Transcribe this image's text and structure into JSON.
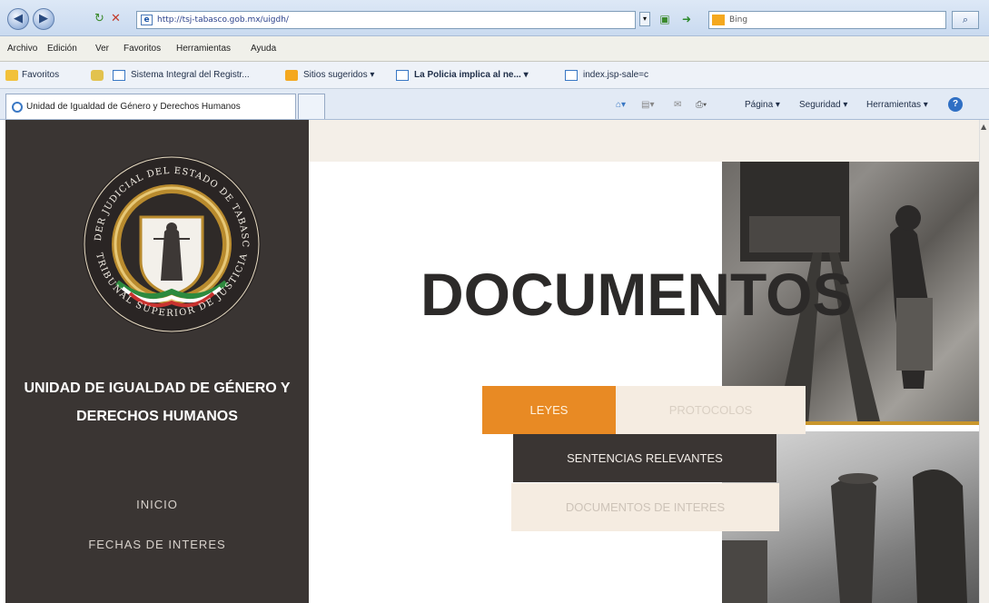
{
  "browser": {
    "address": "http://tsj-tabasco.gob.mx/uigdh/",
    "search_placeholder": "Bing",
    "menu": [
      "Archivo",
      "Edición",
      "Ver",
      "Favoritos",
      "Herramientas",
      "Ayuda"
    ],
    "favorites_label": "Favoritos",
    "favorites": [
      "Sistema Integral del Registr...",
      "Sitios sugeridos ▾",
      "La Policia implica al ne... ▾",
      "index.jsp-sale=c"
    ],
    "tab_title": "Unidad de Igualdad de Género y Derechos Humanos",
    "command_bar": [
      "Página ▾",
      "Seguridad ▾",
      "Herramientas ▾"
    ]
  },
  "seal": {
    "top_text": "PODER JUDICIAL DEL ESTADO DE TABASCO",
    "bottom_text": "TRIBUNAL SUPERIOR DE JUSTICIA"
  },
  "sidebar": {
    "unit_title_line1": "UNIDAD DE IGUALDAD DE GÉNERO Y",
    "unit_title_line2": "DERECHOS HUMANOS",
    "nav": [
      "INICIO",
      "FECHAS DE INTERES"
    ]
  },
  "main": {
    "heading": "DOCUMENTOS",
    "buttons": {
      "leyes": "LEYES",
      "protocolos": "PROTOCOLOS",
      "sentencias": "SENTENCIAS RELEVANTES",
      "documentos": "DOCUMENTOS DE INTERES"
    }
  },
  "colors": {
    "sidebar_bg": "#3a3533",
    "accent_orange": "#e88a24",
    "light_beige": "#f5ece1",
    "seal_gold": "#c9962c"
  }
}
